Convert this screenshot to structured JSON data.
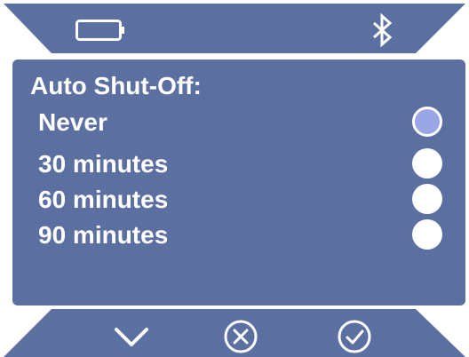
{
  "screen": {
    "title": "Auto Shut-Off:",
    "options": [
      {
        "label": "Never",
        "selected": true
      },
      {
        "label": "30 minutes",
        "selected": false
      },
      {
        "label": "60 minutes",
        "selected": false
      },
      {
        "label": "90 minutes",
        "selected": false
      }
    ]
  },
  "status": {
    "battery_icon": "battery-icon",
    "bluetooth_icon": "bluetooth-icon"
  },
  "buttons": {
    "down_icon": "chevron-down-icon",
    "cancel_icon": "cancel-circle-icon",
    "confirm_icon": "check-circle-icon"
  },
  "colors": {
    "panel": "#5b70a1",
    "text": "#ffffff",
    "selected_radio": "#9aa6e5"
  }
}
